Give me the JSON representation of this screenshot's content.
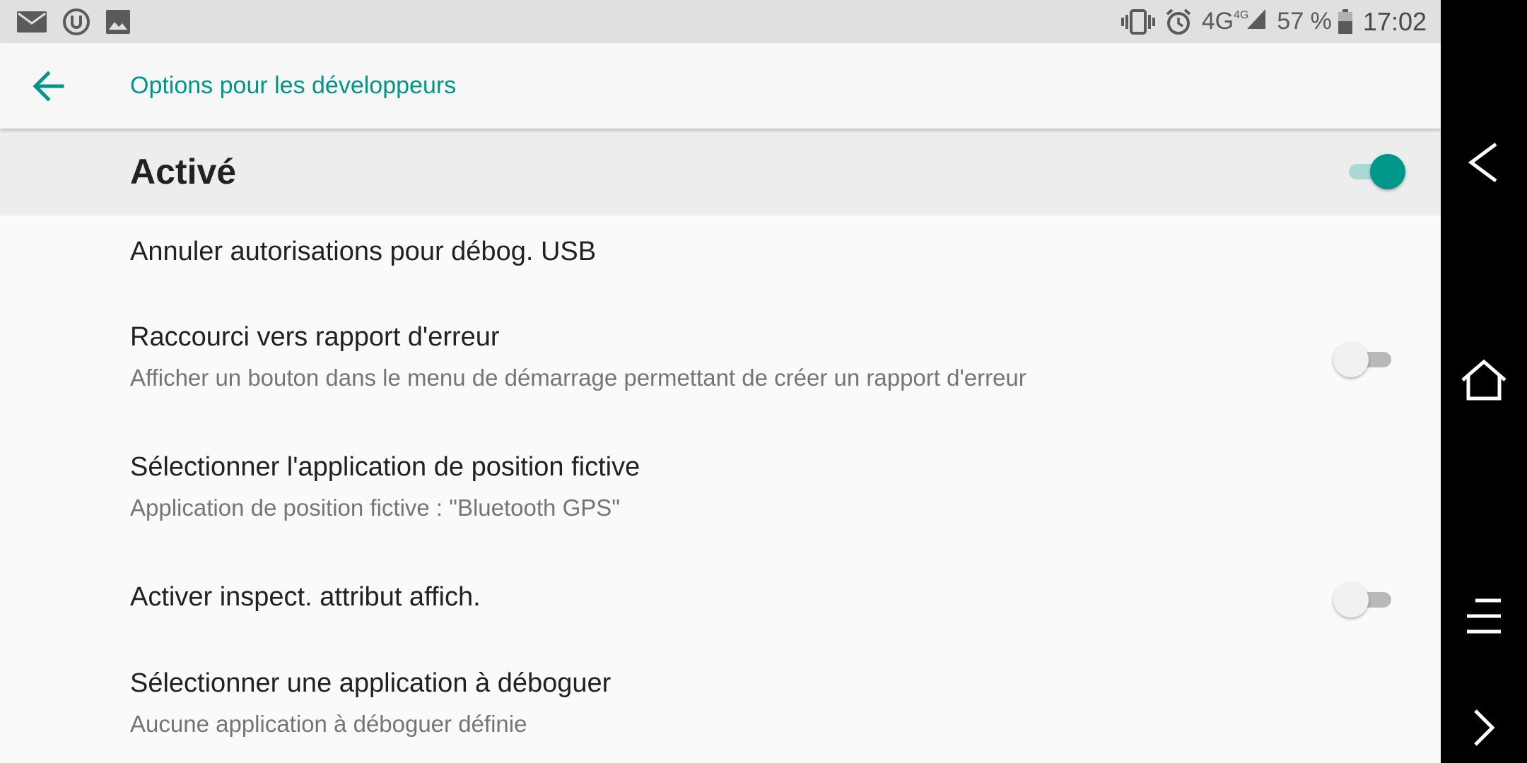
{
  "status_bar": {
    "left_icons": [
      "mail-icon",
      "u-badge-icon",
      "image-icon"
    ],
    "right_icons": [
      "vibrate-icon",
      "alarm-icon"
    ],
    "network": "4G",
    "network_small": "4G",
    "battery": "57 %",
    "time": "17:02"
  },
  "toolbar": {
    "back_icon": "arrow-back-icon",
    "title": "Options pour les développeurs"
  },
  "master_switch": {
    "label": "Activé",
    "checked": true
  },
  "preferences": [
    {
      "title": "Annuler autorisations pour débog. USB"
    },
    {
      "title": "Raccourci vers rapport d'erreur",
      "summary": "Afficher un bouton dans le menu de démarrage permettant de créer un rapport d'erreur",
      "checked": false
    },
    {
      "title": "Sélectionner l'application de position fictive",
      "summary": "Application de position fictive : \"Bluetooth GPS\""
    },
    {
      "title": "Activer inspect. attribut affich.",
      "checked": false
    },
    {
      "title": "Sélectionner une application à déboguer",
      "summary": "Aucune application à déboguer définie"
    }
  ],
  "nav_bar": {
    "icons": [
      "back-icon",
      "home-icon",
      "menu-icon",
      "forward-icon"
    ]
  },
  "colors": {
    "accent": "#00968a",
    "status_bar_bg": "#e0e0e0",
    "nav_bar_bg": "#000000"
  }
}
